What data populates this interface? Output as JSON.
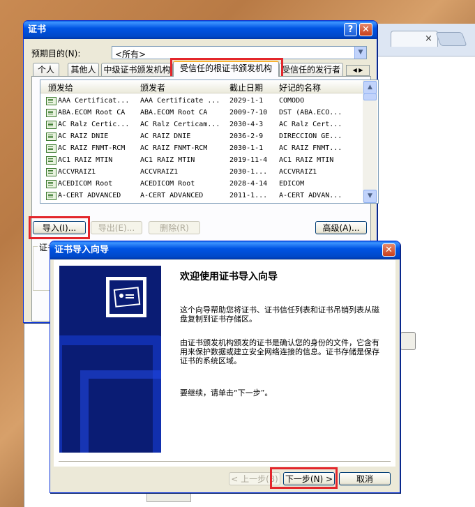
{
  "cert_window": {
    "title": "证书",
    "purpose_label": "预期目的(N):",
    "purpose_value": "<所有>",
    "tabs": [
      "个人",
      "其他人",
      "中级证书颁发机构",
      "受信任的根证书颁发机构",
      "受信任的发行者"
    ],
    "columns": [
      "颁发给",
      "颁发者",
      "截止日期",
      "好记的名称"
    ],
    "rows": [
      {
        "to": "AAA Certificat...",
        "by": "AAA Certificate ...",
        "exp": "2029-1-1",
        "name": "COMODO"
      },
      {
        "to": "ABA.ECOM Root CA",
        "by": "ABA.ECOM Root CA",
        "exp": "2009-7-10",
        "name": "DST (ABA.ECO..."
      },
      {
        "to": "AC Ralz Certic...",
        "by": "AC Ralz Certicam...",
        "exp": "2030-4-3",
        "name": "AC Ralz Cert..."
      },
      {
        "to": "AC RAIZ DNIE",
        "by": "AC RAIZ DNIE",
        "exp": "2036-2-9",
        "name": "DIRECCION GE..."
      },
      {
        "to": "AC RAIZ FNMT-RCM",
        "by": "AC RAIZ FNMT-RCM",
        "exp": "2030-1-1",
        "name": "AC RAIZ FNMT..."
      },
      {
        "to": "AC1 RAIZ MTIN",
        "by": "AC1 RAIZ MTIN",
        "exp": "2019-11-4",
        "name": "AC1 RAIZ MTIN"
      },
      {
        "to": "ACCVRAIZ1",
        "by": "ACCVRAIZ1",
        "exp": "2030-1...",
        "name": "ACCVRAIZ1"
      },
      {
        "to": "ACEDICOM Root",
        "by": "ACEDICOM Root",
        "exp": "2028-4-14",
        "name": "EDICOM"
      },
      {
        "to": "A-CERT ADVANCED",
        "by": "A-CERT ADVANCED",
        "exp": "2011-1...",
        "name": "A-CERT ADVAN..."
      }
    ],
    "import_label": "导入(I)...",
    "export_label": "导出(E)...",
    "remove_label": "删除(R)",
    "advanced_label": "高级(A)...",
    "group_label": "证书"
  },
  "wizard": {
    "title": "证书导入向导",
    "heading": "欢迎使用证书导入向导",
    "para1": "这个向导帮助您将证书、证书信任列表和证书吊销列表从磁盘复制到证书存储区。",
    "para2": "由证书颁发机构颁发的证书是确认您的身份的文件，它含有用来保护数据或建立安全网络连接的信息。证书存储是保存证书的系统区域。",
    "para3": "要继续，请单击“下一步”。",
    "back_label": "< 上一步(B)",
    "next_label": "下一步(N) >",
    "cancel_label": "取消"
  },
  "colors": {
    "highlight": "#e3262b",
    "xp_title": "#0054e3",
    "wizard_panel": "#0a1c74"
  }
}
